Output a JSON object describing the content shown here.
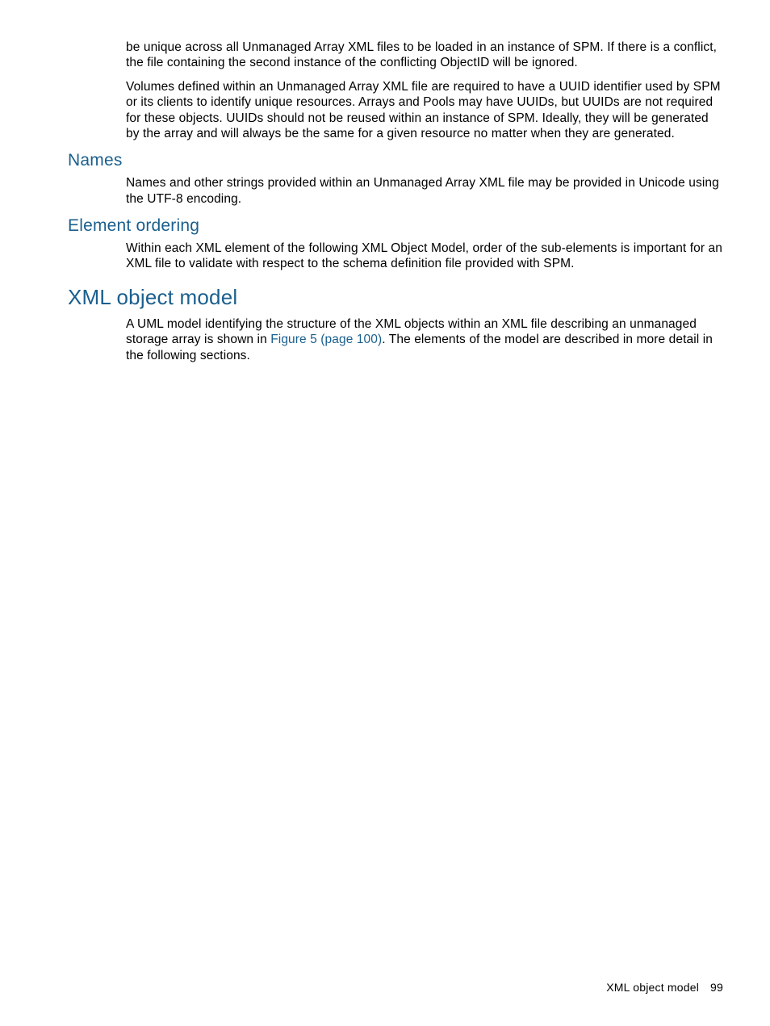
{
  "paragraphs": {
    "intro1": "be unique across all Unmanaged Array XML files to be loaded in an instance of SPM. If there is a conflict, the file containing the second instance of the conflicting ObjectID will be ignored.",
    "intro2": "Volumes defined within an Unmanaged Array XML file are required to have a UUID identifier used by SPM or its clients to identify unique resources. Arrays and Pools may have UUIDs, but UUIDs are not required for these objects. UUIDs should not be reused within an instance of SPM. Ideally, they will be generated by the array and will always be the same for a given resource no matter when they are generated.",
    "names_body": "Names and other strings provided within an Unmanaged Array XML file may be provided in Unicode using the UTF-8 encoding.",
    "element_ordering_body": "Within each XML element of the following XML Object Model, order of the sub-elements is important for an XML file to validate with respect to the schema definition file provided with SPM.",
    "xml_body_pre": "A UML model identifying the structure of the XML objects within an XML file describing an unmanaged storage array is shown in ",
    "xml_body_link": "Figure 5 (page 100)",
    "xml_body_post": ". The elements of the model are described in more detail in the following sections."
  },
  "headings": {
    "names": "Names",
    "element_ordering": "Element ordering",
    "xml_object_model": "XML object model"
  },
  "footer": {
    "label": "XML object model",
    "page": "99"
  }
}
